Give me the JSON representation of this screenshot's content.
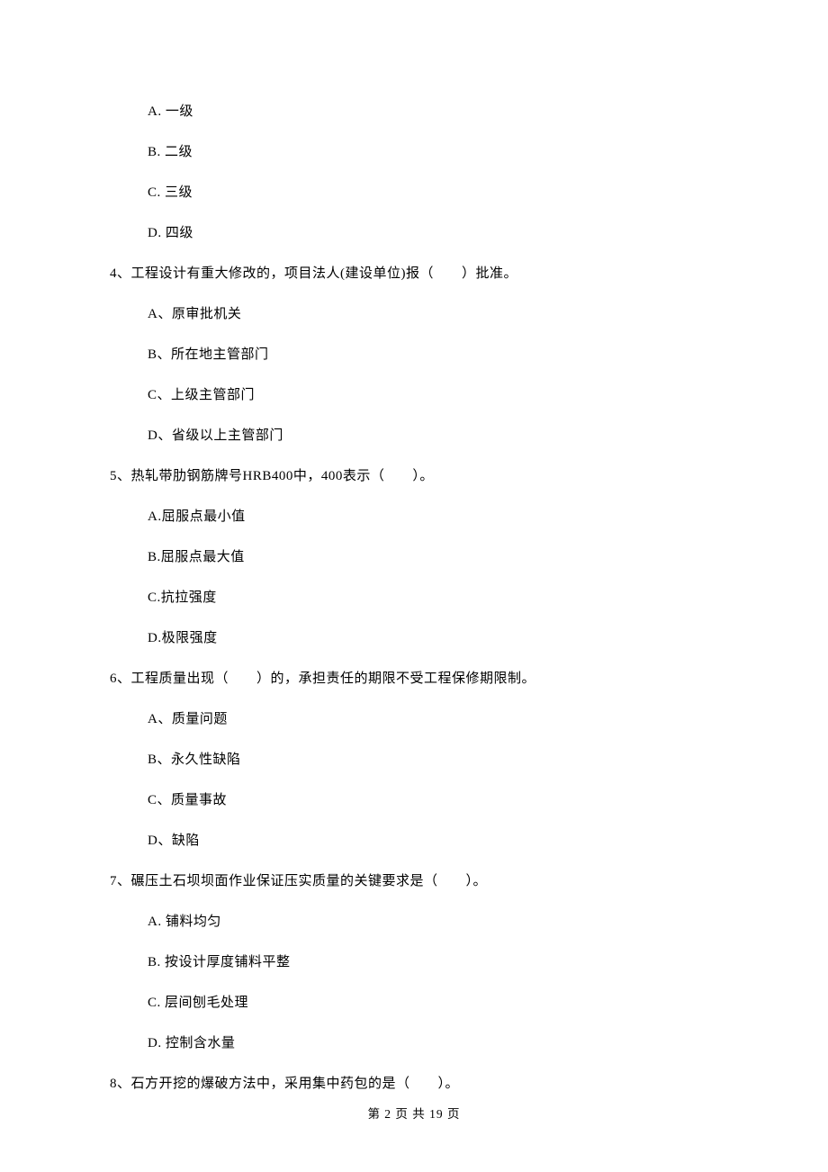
{
  "q3_options": {
    "a": "A.  一级",
    "b": "B.  二级",
    "c": "C.  三级",
    "d": "D.  四级"
  },
  "q4": {
    "text": "4、工程设计有重大修改的，项目法人(建设单位)报（　　）批准。",
    "a": "A、原审批机关",
    "b": "B、所在地主管部门",
    "c": "C、上级主管部门",
    "d": "D、省级以上主管部门"
  },
  "q5": {
    "text": "5、热轧带肋钢筋牌号HRB400中，400表示（　　）。",
    "a": "A.屈服点最小值",
    "b": "B.屈服点最大值",
    "c": "C.抗拉强度",
    "d": "D.极限强度"
  },
  "q6": {
    "text": "6、工程质量出现（　　）的，承担责任的期限不受工程保修期限制。",
    "a": "A、质量问题",
    "b": "B、永久性缺陷",
    "c": "C、质量事故",
    "d": "D、缺陷"
  },
  "q7": {
    "text": "7、碾压土石坝坝面作业保证压实质量的关键要求是（　　）。",
    "a": "A.  铺料均匀",
    "b": "B.  按设计厚度铺料平整",
    "c": "C.  层间刨毛处理",
    "d": "D.  控制含水量"
  },
  "q8": {
    "text": "8、石方开挖的爆破方法中，采用集中药包的是（　　）。"
  },
  "footer": "第 2 页 共 19 页"
}
